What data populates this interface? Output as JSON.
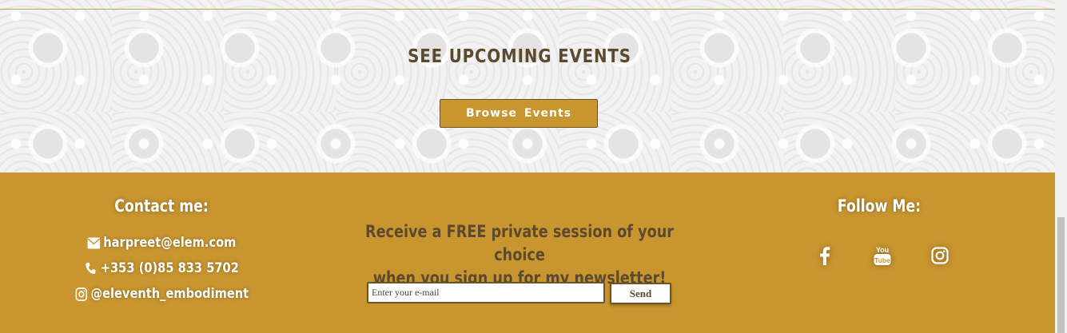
{
  "events": {
    "title": "SEE UPCOMING EVENTS",
    "browse_label": "Browse  Events"
  },
  "contact": {
    "heading": "Contact me:",
    "email": "harpreet@elem.com",
    "phone": "+353 (0)85 833 5702",
    "instagram": "@eleventh_embodiment"
  },
  "newsletter": {
    "line1": "Receive a FREE private session of your choice",
    "line2": "when you sign up for my newsletter!",
    "placeholder": "Enter your e-mail",
    "send_label": "Send"
  },
  "follow": {
    "heading": "Follow Me:",
    "icons": [
      "facebook-icon",
      "youtube-icon",
      "instagram-icon"
    ]
  },
  "colors": {
    "accent": "#c9952f",
    "text_dark": "#5c4a2e",
    "border": "#6b5428"
  }
}
